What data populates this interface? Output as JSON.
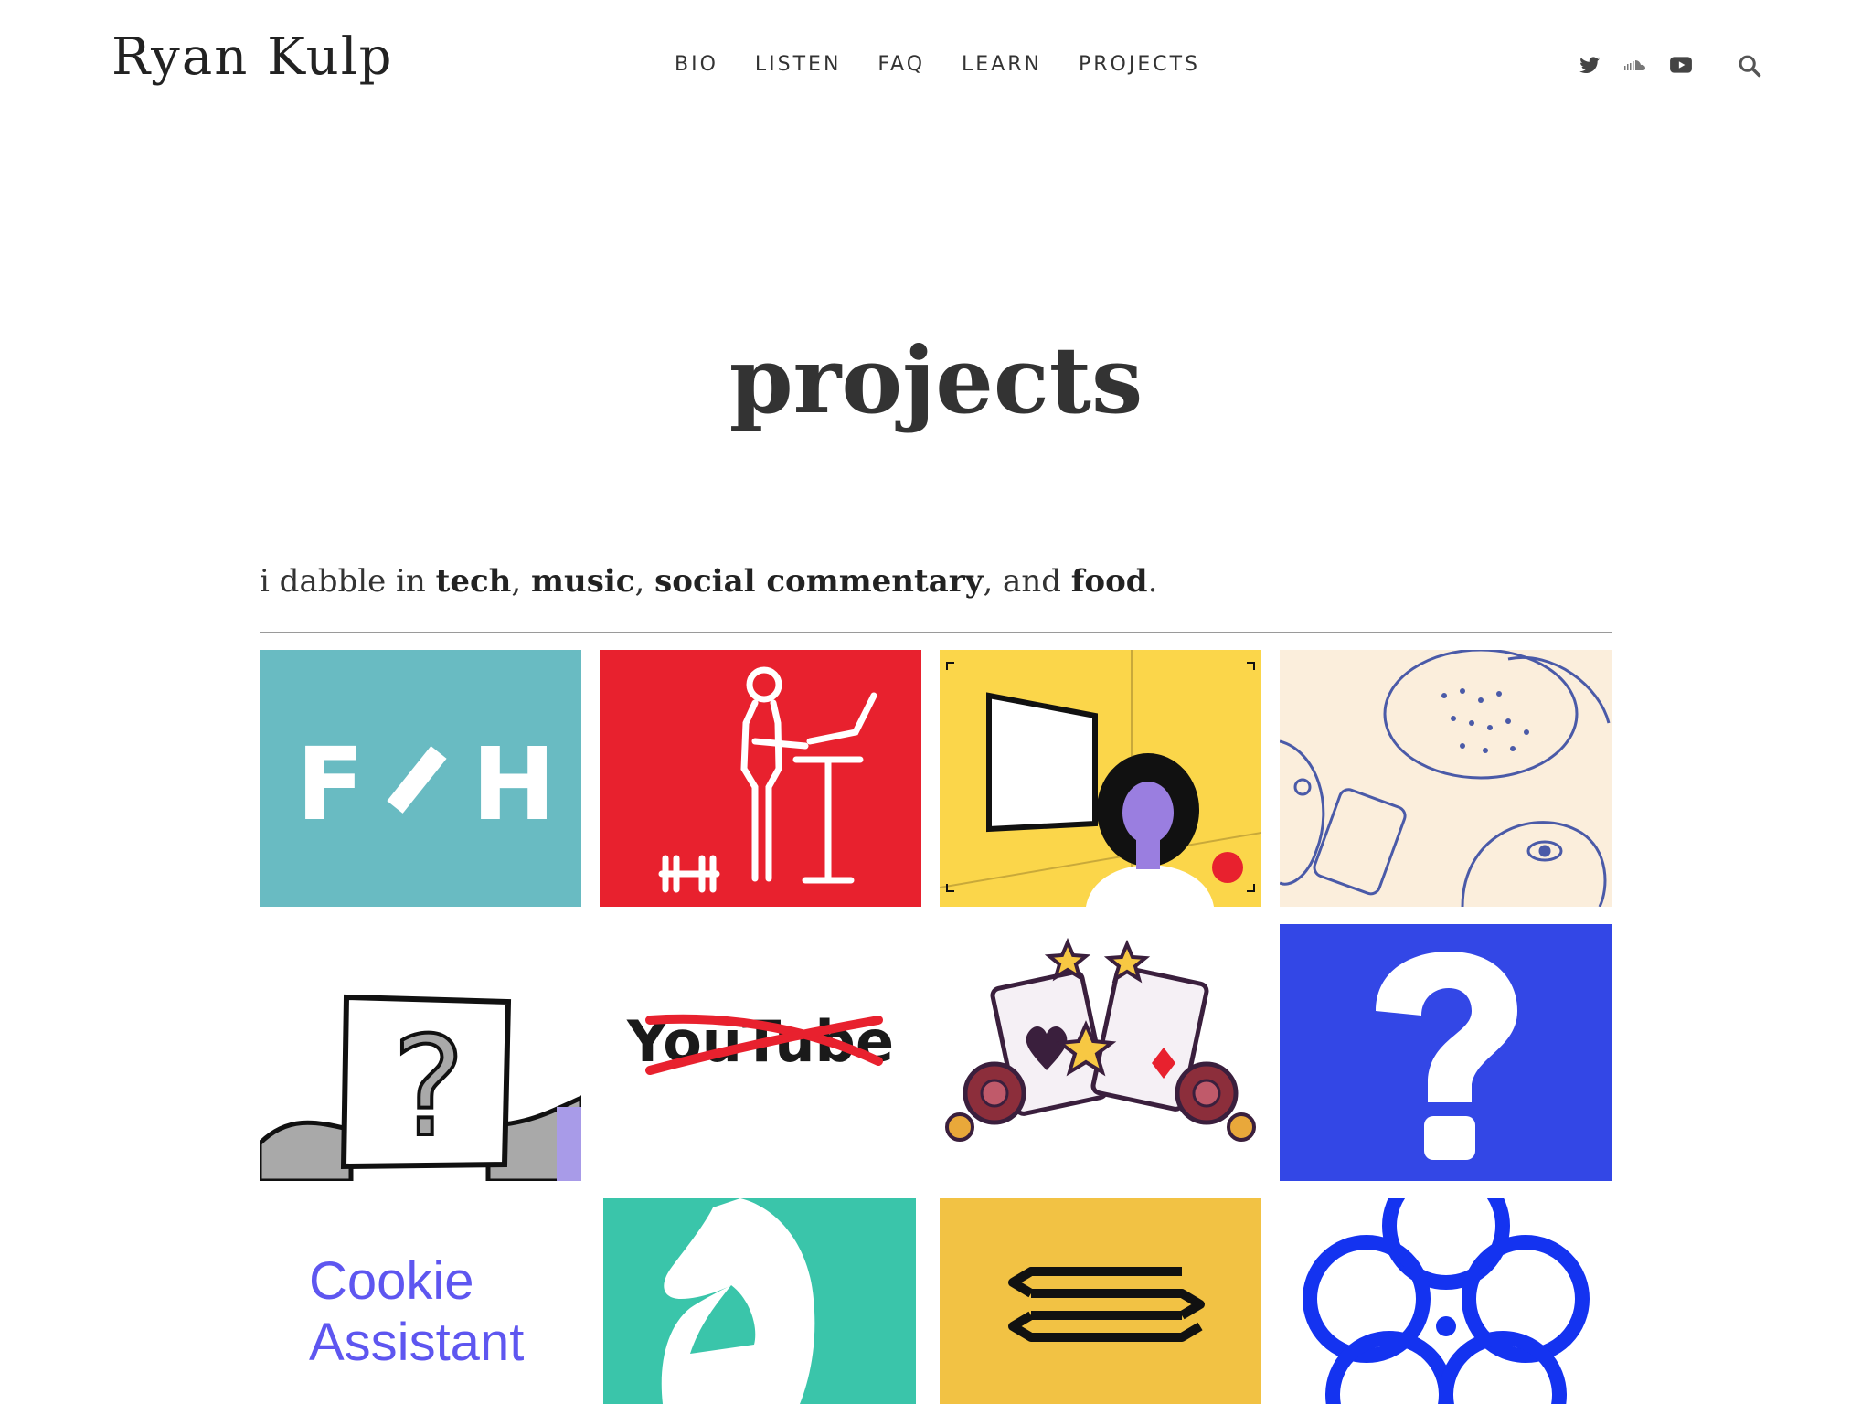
{
  "header": {
    "site_title": "Ryan Kulp",
    "nav": [
      "BIO",
      "LISTEN",
      "FAQ",
      "LEARN",
      "PROJECTS"
    ],
    "social_icons": [
      "twitter-icon",
      "soundcloud-icon",
      "youtube-icon"
    ],
    "search_icon": "search-icon"
  },
  "main": {
    "title": "projects",
    "intro": {
      "prefix": "i dabble in ",
      "items": [
        "tech",
        "music",
        "social commentary",
        "food"
      ],
      "sep1": ", ",
      "sep2": ", ",
      "sep3": ", and ",
      "suffix": "."
    },
    "tiles": {
      "fh_text_f": "F",
      "fh_text_h": "H",
      "youtube_text": "YouTube",
      "cookie_line1": "Cookie",
      "cookie_line2": "Assistant"
    }
  },
  "colors": {
    "fh_teal": "#69BBC2",
    "desk_red": "#E8212E",
    "video_yellow": "#FBD64A",
    "cream": "#FBEEDC",
    "question_blue": "#3347E6",
    "mint": "#3AC5AA",
    "mustard": "#F2C244",
    "flower_blue": "#1433F0",
    "cookie_purple": "#5E56F0"
  }
}
